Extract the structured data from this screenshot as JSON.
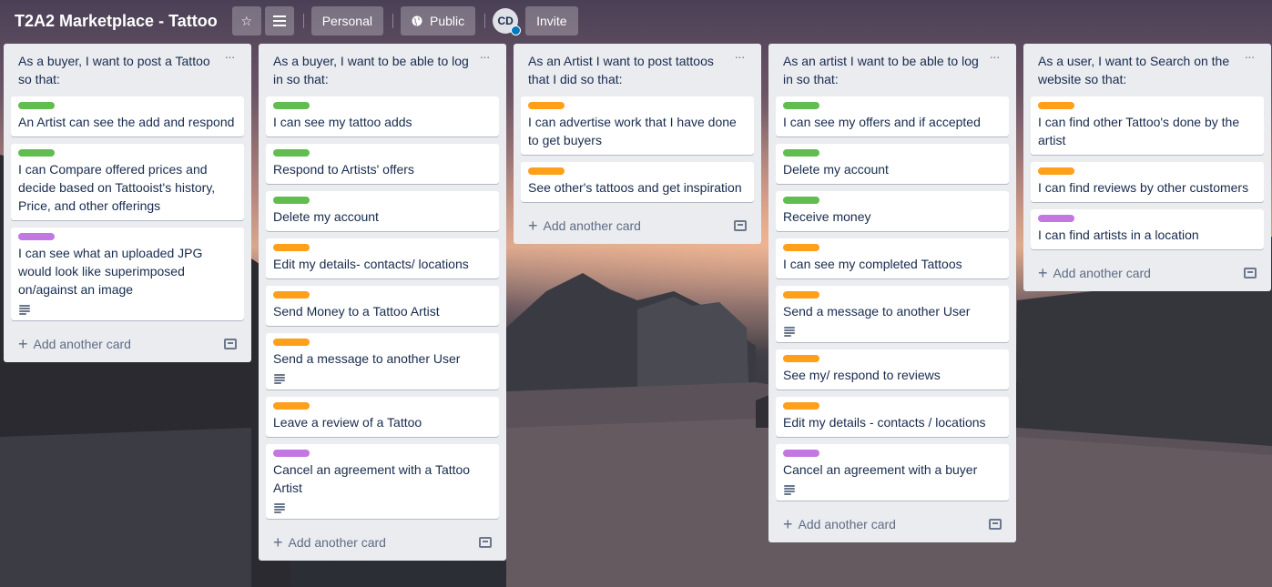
{
  "board": {
    "title": "T2A2 Marketplace - Tattoo",
    "visibility_team": "Personal",
    "visibility": "Public",
    "member_initials": "CD",
    "invite_label": "Invite"
  },
  "colors": {
    "green": "#61bd4f",
    "orange": "#ff9f1a",
    "purple": "#c377e0"
  },
  "icons": {
    "star": "star-icon",
    "menu": "menu-lines-icon",
    "globe": "globe-icon",
    "description": "description-icon",
    "template": "card-template-icon",
    "plus": "plus-icon"
  },
  "add_card_label": "Add another card",
  "lists": [
    {
      "title": "As a buyer, I want to post a Tattoo so that:",
      "cards": [
        {
          "label": "green",
          "text": "An Artist can see the add and respond",
          "desc": false
        },
        {
          "label": "green",
          "text": "I can Compare offered prices and decide based on Tattooist's history, Price, and other offerings",
          "desc": false
        },
        {
          "label": "purple",
          "text": "I can see what an uploaded JPG would look like superimposed on/against an image",
          "desc": true
        }
      ]
    },
    {
      "title": "As a buyer, I want to be able to log in so that:",
      "cards": [
        {
          "label": "green",
          "text": "I can see my tattoo adds",
          "desc": false
        },
        {
          "label": "green",
          "text": "Respond to Artists' offers",
          "desc": false
        },
        {
          "label": "green",
          "text": "Delete my account",
          "desc": false
        },
        {
          "label": "orange",
          "text": "Edit my details- contacts/ locations",
          "desc": false
        },
        {
          "label": "orange",
          "text": "Send Money to a Tattoo Artist",
          "desc": false
        },
        {
          "label": "orange",
          "text": "Send a message to another User",
          "desc": true
        },
        {
          "label": "orange",
          "text": "Leave a review of a Tattoo",
          "desc": false
        },
        {
          "label": "purple",
          "text": "Cancel an agreement with a Tattoo Artist",
          "desc": true
        }
      ]
    },
    {
      "title": "As an Artist I want to post tattoos that I did so that:",
      "cards": [
        {
          "label": "orange",
          "text": "I can advertise work that I have done to get buyers",
          "desc": false
        },
        {
          "label": "orange",
          "text": "See other's tattoos and get inspiration",
          "desc": false
        }
      ]
    },
    {
      "title": "As an artist I want to be able to log in so that:",
      "cards": [
        {
          "label": "green",
          "text": "I can see my offers and if accepted",
          "desc": false
        },
        {
          "label": "green",
          "text": "Delete my account",
          "desc": false
        },
        {
          "label": "green",
          "text": "Receive money",
          "desc": false
        },
        {
          "label": "orange",
          "text": "I can see my completed Tattoos",
          "desc": false
        },
        {
          "label": "orange",
          "text": "Send a message to another User",
          "desc": true
        },
        {
          "label": "orange",
          "text": "See my/ respond to reviews",
          "desc": false
        },
        {
          "label": "orange",
          "text": "Edit my details - contacts / locations",
          "desc": false
        },
        {
          "label": "purple",
          "text": "Cancel an agreement with a buyer",
          "desc": true
        }
      ]
    },
    {
      "title": "As a user, I want to Search on the website so that:",
      "cards": [
        {
          "label": "orange",
          "text": "I can find other Tattoo's done by the artist",
          "desc": false
        },
        {
          "label": "orange",
          "text": "I can find reviews by other customers",
          "desc": false
        },
        {
          "label": "purple",
          "text": "I can find artists in a location",
          "desc": false
        }
      ]
    }
  ]
}
